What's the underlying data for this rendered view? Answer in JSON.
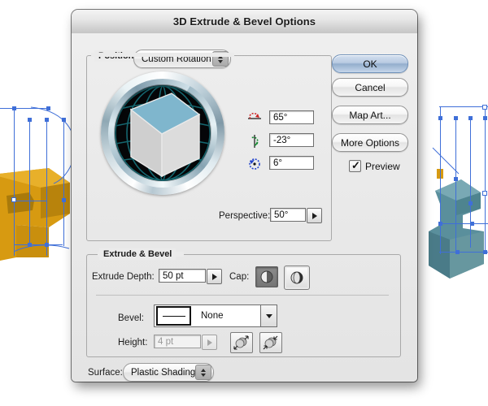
{
  "window": {
    "title": "3D Extrude & Bevel Options"
  },
  "position_group": {
    "legend": "Position:",
    "preset": "Custom Rotation",
    "rotation": [
      {
        "axis": "x",
        "icon": "rotate-x-axis-icon",
        "value": "65°",
        "color": "#cc2222"
      },
      {
        "axis": "y",
        "icon": "rotate-y-axis-icon",
        "value": "-23°",
        "color": "#118a2e"
      },
      {
        "axis": "z",
        "icon": "rotate-z-axis-icon",
        "value": "6°",
        "color": "#2244cc"
      }
    ],
    "perspective": {
      "label": "Perspective:",
      "value": "50°"
    }
  },
  "extrude_group": {
    "legend": "Extrude & Bevel",
    "extrude_depth": {
      "label": "Extrude Depth:",
      "value": "50 pt"
    },
    "cap": {
      "label": "Cap:",
      "options": [
        {
          "name": "cap-solid-button",
          "selected": true
        },
        {
          "name": "cap-hollow-button",
          "selected": false
        }
      ]
    },
    "bevel": {
      "label": "Bevel:",
      "value": "None"
    },
    "height": {
      "label": "Height:",
      "value": "4 pt",
      "disabled": true,
      "extent_buttons": [
        {
          "name": "bevel-extent-out-button"
        },
        {
          "name": "bevel-extent-in-button"
        }
      ]
    }
  },
  "surface": {
    "label": "Surface:",
    "value": "Plastic Shading"
  },
  "buttons": {
    "ok": "OK",
    "cancel": "Cancel",
    "map_art": "Map Art...",
    "more_options": "More Options"
  },
  "preview": {
    "label": "Preview",
    "checked": true,
    "tick": "✓"
  },
  "colors": {
    "dialog_bg": "#e9e9e9",
    "default_button": "#93aecd",
    "cube_top": "#7fb6cd",
    "cube_side_light": "#d8d8d8",
    "cube_side_dark": "#b4b4b4",
    "globe_wire": "#1b6f78",
    "artwork_left": "#d79a11",
    "artwork_right": "#5a8f9c",
    "selection": "#3f6fd8"
  }
}
